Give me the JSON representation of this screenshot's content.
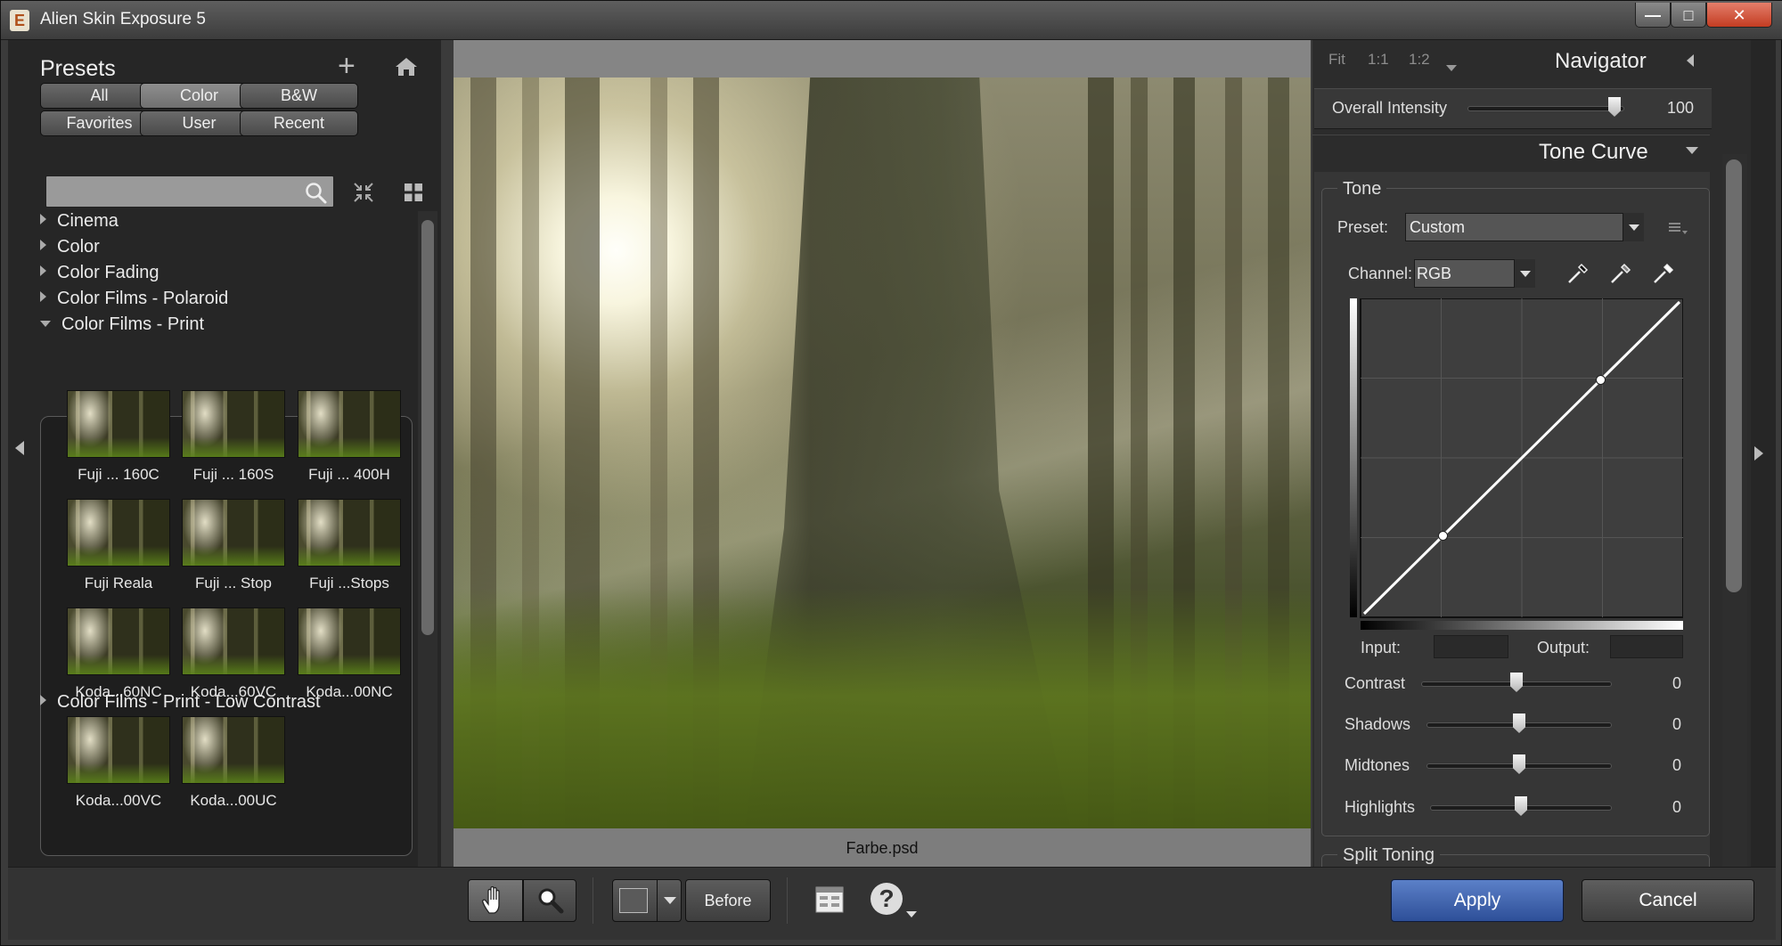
{
  "window": {
    "title": "Alien Skin Exposure 5",
    "app_icon_letter": "E"
  },
  "presets": {
    "title": "Presets",
    "filter_buttons": [
      "All",
      "Color",
      "B&W",
      "Favorites",
      "User",
      "Recent"
    ],
    "active_filter": "Color",
    "search": {
      "value": "",
      "placeholder": ""
    },
    "categories_before": [
      "Cinema",
      "Color",
      "Color Fading",
      "Color Films - Polaroid"
    ],
    "open_category": "Color Films - Print",
    "thumbnails": [
      "Fuji ... 160C",
      "Fuji ... 160S",
      "Fuji ... 400H",
      "Fuji Reala",
      "Fuji ... Stop",
      "Fuji ...Stops",
      "Koda...60NC",
      "Koda...60VC",
      "Koda...00NC",
      "Koda...00VC",
      "Koda...00UC"
    ],
    "categories_after": [
      "Color Films - Print - Low Contrast"
    ]
  },
  "image": {
    "filename": "Farbe.psd"
  },
  "navigator": {
    "zoom_options": [
      "Fit",
      "1:1",
      "1:2"
    ],
    "title": "Navigator",
    "overall_intensity": {
      "label": "Overall Intensity",
      "value": 100,
      "max": 100
    }
  },
  "tone_curve": {
    "title": "Tone Curve",
    "group": "Tone",
    "preset_label": "Preset:",
    "preset_value": "Custom",
    "channel_label": "Channel:",
    "channel_value": "RGB",
    "curve_points": [
      [
        0,
        0
      ],
      [
        0.25,
        0.25
      ],
      [
        0.75,
        0.75
      ],
      [
        1,
        1
      ]
    ],
    "input_label": "Input:",
    "output_label": "Output:",
    "sliders": [
      {
        "label": "Contrast",
        "value": 0
      },
      {
        "label": "Shadows",
        "value": 0
      },
      {
        "label": "Midtones",
        "value": 0
      },
      {
        "label": "Highlights",
        "value": 0
      }
    ],
    "next_group": "Split Toning"
  },
  "toolbar": {
    "before_label": "Before",
    "help_glyph": "?",
    "apply_label": "Apply",
    "cancel_label": "Cancel"
  },
  "colors": {
    "apply_blue": "#3f63b0",
    "panel_dark": "#262626"
  },
  "icons": [
    "hand-icon",
    "zoom-icon",
    "layout-icon",
    "help-icon",
    "search-icon",
    "home-icon",
    "add-icon",
    "collapse-icon",
    "grid-icon",
    "eyedropper-icon"
  ]
}
